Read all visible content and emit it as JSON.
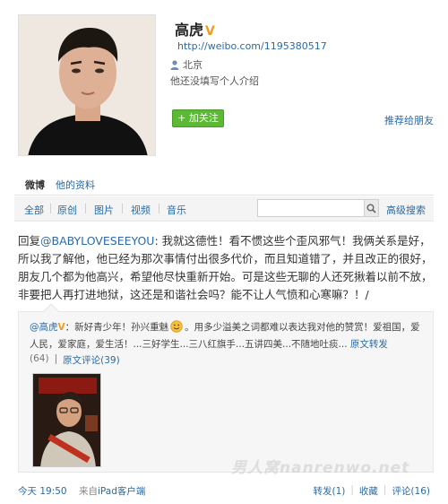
{
  "profile": {
    "name": "高虎",
    "url": "http://weibo.com/1195380517",
    "location": "北京",
    "bio": "他还没填写个人介绍",
    "follow_label": "+ 加关注",
    "recommend_label": "推荐给朋友"
  },
  "tabs": [
    {
      "label": "微博"
    },
    {
      "label": "他的资料"
    }
  ],
  "filters": [
    {
      "label": "全部"
    },
    {
      "label": "原创"
    },
    {
      "label": "图片"
    },
    {
      "label": "视频"
    },
    {
      "label": "音乐"
    }
  ],
  "search": {
    "placeholder": "",
    "advanced_label": "高级搜索"
  },
  "post": {
    "prefix": "回复",
    "mention": "@BABYLOVESEEYOU",
    "text": ": 我就这德性！看不惯这些个歪风邪气！我俩关系是好，所以我了解他，他已经为那次事情付出很多代价，而且知道错了，并且改正的很好，朋友几个都为他高兴，希望他尽快重新开始。可是这些无聊的人还死揪着以前不放，非要把人再打进地狱，这还是和谐社会吗？能不让人气愤和心寒嘛？！/"
  },
  "repost": {
    "author": "@高虎",
    "text_a": "：新好青少年！孙兴重魅",
    "text_b": "。用多少溢美之词都难以表达我对他的赞赏！爱祖国，爱人民，爱家庭，爱生活！...三好学生...三八红旗手...五讲四美...不随地吐痰...",
    "repost_link": "原文转发",
    "repost_count": "(64)",
    "comment_label": "原文评论(39)"
  },
  "watermark": "男人窝nanrenwo.net",
  "footer": {
    "time": "今天 19:50",
    "source_prefix": "来自",
    "source": "iPad客户端",
    "repost": "转发(1)",
    "favorite": "收藏",
    "comment": "评论(16)"
  },
  "colors": {
    "link": "#2b6aa6",
    "follow": "#5cb935",
    "badge": "#f29b1a"
  }
}
